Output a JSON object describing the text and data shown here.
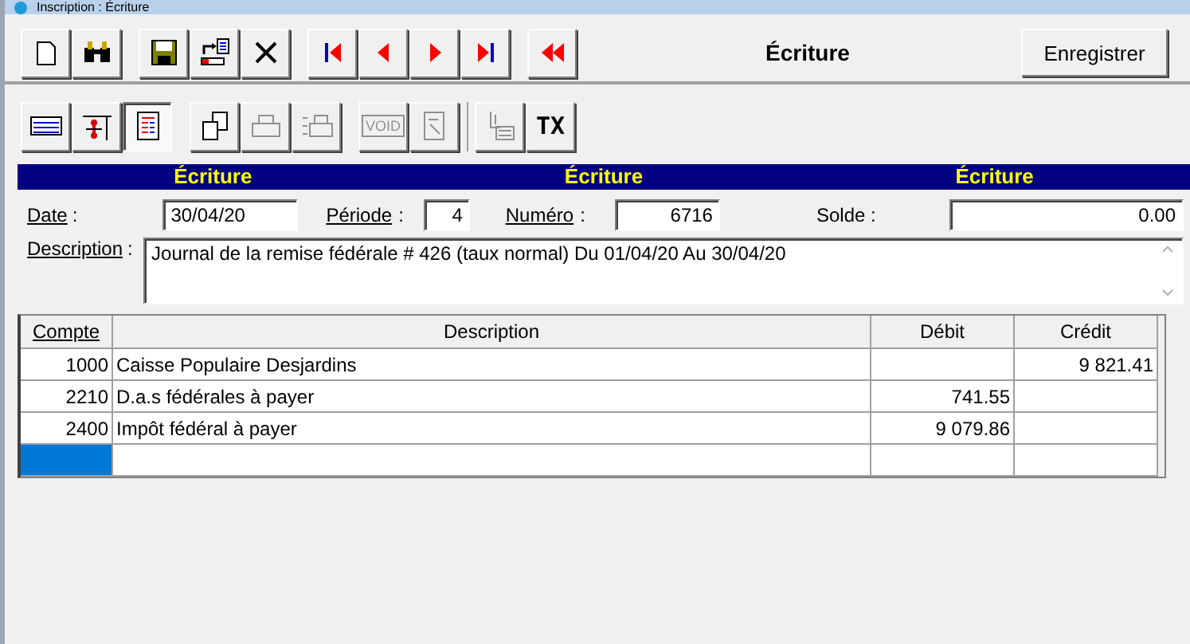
{
  "window": {
    "title": "Inscription : Écriture"
  },
  "toolbar_top": {
    "groups": [
      [
        {
          "kind": "new"
        },
        {
          "kind": "find"
        }
      ],
      [
        {
          "kind": "save"
        },
        {
          "kind": "export"
        },
        {
          "kind": "delete"
        }
      ],
      [
        {
          "kind": "first"
        },
        {
          "kind": "prev"
        },
        {
          "kind": "next"
        },
        {
          "kind": "last"
        }
      ],
      [
        {
          "kind": "rewind"
        }
      ]
    ],
    "heading": "Écriture",
    "save_button": "Enregistrer"
  },
  "toolbar_bottom": {
    "groups": [
      [
        {
          "kind": "lines",
          "pressed": false,
          "disabled": false
        },
        {
          "kind": "split",
          "pressed": false,
          "disabled": false
        },
        {
          "kind": "form",
          "pressed": true,
          "disabled": false
        }
      ],
      [
        {
          "kind": "copy",
          "pressed": false,
          "disabled": false
        },
        {
          "kind": "print",
          "pressed": false,
          "disabled": true
        },
        {
          "kind": "print_batch",
          "pressed": false,
          "disabled": true
        }
      ],
      [
        {
          "kind": "void",
          "label": "VOID",
          "pressed": false,
          "disabled": true
        },
        {
          "kind": "doc",
          "pressed": false,
          "disabled": true
        }
      ],
      [
        {
          "kind": "printer_stack",
          "pressed": false,
          "disabled": true
        },
        {
          "kind": "text",
          "label": "TX",
          "pressed": false,
          "disabled": false
        }
      ]
    ]
  },
  "banner": [
    "Écriture",
    "Écriture",
    "Écriture"
  ],
  "form": {
    "date_label": "Date",
    "date": "30/04/20",
    "period_label": "Période",
    "period": "4",
    "number_label": "Numéro",
    "number": "6716",
    "balance_label": "Solde :",
    "balance": "0.00",
    "description_label": "Description",
    "description": "Journal de la remise fédérale # 426 (taux normal) Du 01/04/20 Au 30/04/20",
    "colon": ":"
  },
  "table": {
    "columns": [
      "Compte",
      "Description",
      "Débit",
      "Crédit"
    ],
    "rows": [
      {
        "account": "1000",
        "description": "Caisse Populaire Desjardins",
        "debit": "",
        "credit": "9 821.41",
        "selected": false
      },
      {
        "account": "2210",
        "description": "D.a.s fédérales à payer",
        "debit": "741.55",
        "credit": "",
        "selected": false
      },
      {
        "account": "2400",
        "description": "Impôt fédéral à payer",
        "debit": "9 079.86",
        "credit": "",
        "selected": false
      },
      {
        "account": "",
        "description": "",
        "debit": "",
        "credit": "",
        "selected": true
      }
    ]
  }
}
